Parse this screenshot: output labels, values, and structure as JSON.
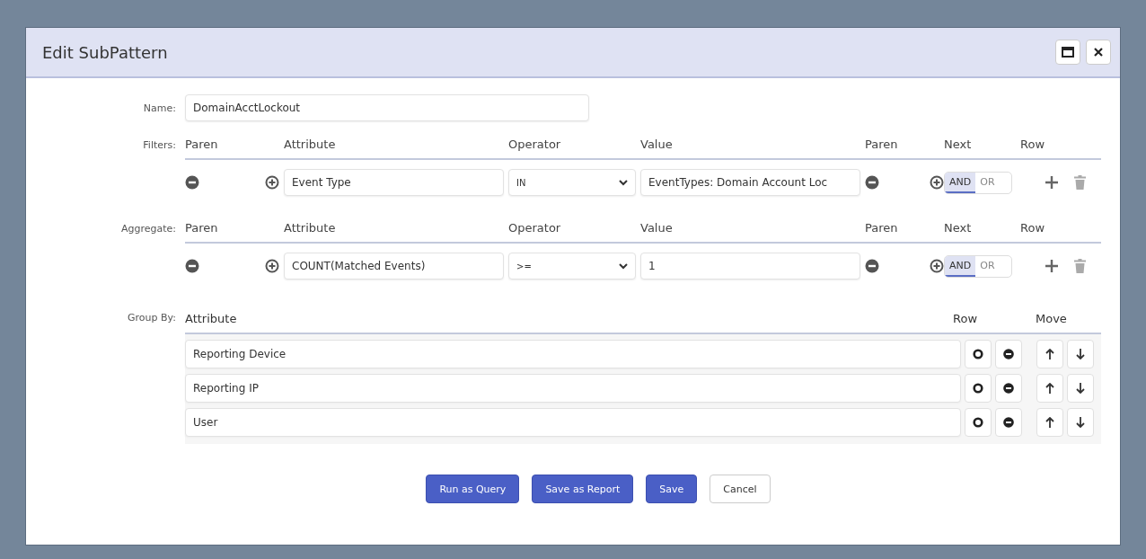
{
  "dialog": {
    "title": "Edit SubPattern"
  },
  "name": {
    "label": "Name:",
    "value": "DomainAcctLockout"
  },
  "filters": {
    "label": "Filters:",
    "columns": [
      "Paren",
      "Attribute",
      "Operator",
      "Value",
      "Paren",
      "Next",
      "Row"
    ],
    "rows": [
      {
        "attribute": "Event Type",
        "operator": "IN",
        "value": "EventTypes: Domain Account Loc",
        "next": [
          {
            "label": "AND",
            "selected": true
          },
          {
            "label": "OR",
            "selected": false
          }
        ]
      }
    ]
  },
  "aggregate": {
    "label": "Aggregate:",
    "columns": [
      "Paren",
      "Attribute",
      "Operator",
      "Value",
      "Paren",
      "Next",
      "Row"
    ],
    "rows": [
      {
        "attribute": "COUNT(Matched Events)",
        "operator": ">=",
        "value": "1",
        "next": [
          {
            "label": "AND",
            "selected": true
          },
          {
            "label": "OR",
            "selected": false
          }
        ]
      }
    ]
  },
  "group_by": {
    "label": "Group By:",
    "columns": [
      "Attribute",
      "Row",
      "Move"
    ],
    "rows": [
      {
        "attribute": "Reporting Device"
      },
      {
        "attribute": "Reporting IP"
      },
      {
        "attribute": "User"
      }
    ]
  },
  "buttons": [
    {
      "label": "Run as Query",
      "kind": "primary"
    },
    {
      "label": "Save as Report",
      "kind": "primary"
    },
    {
      "label": "Save",
      "kind": "primary"
    },
    {
      "label": "Cancel",
      "kind": "secondary"
    }
  ]
}
